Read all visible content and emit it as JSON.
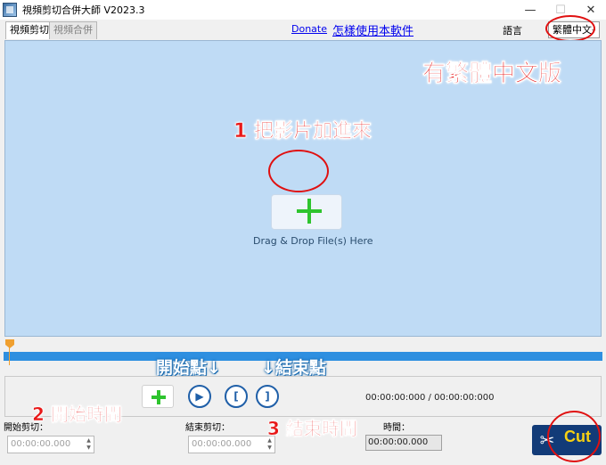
{
  "window": {
    "title": "視頻剪切合併大師 V2023.3",
    "minimize": "—",
    "maximize": "☐",
    "close": "✕"
  },
  "tabs": [
    {
      "label": "視頻剪切"
    },
    {
      "label": "視頻合併"
    }
  ],
  "links": {
    "donate": "Donate",
    "howto": "怎樣使用本軟件"
  },
  "language": {
    "label": "語言",
    "selected": "繁體中文"
  },
  "drop_area": {
    "text": "Drag & Drop File(s) Here"
  },
  "annotations": {
    "traditional_chinese": "有繁體中文版",
    "step1": "1 把影片加進來",
    "start_point": "開始點↓",
    "end_point": "↓結束點",
    "step2": "2 開始時間",
    "step3": "3 結束時間"
  },
  "controls": {
    "play_symbol": "▶",
    "mark_start_symbol": "[",
    "mark_end_symbol": "]",
    "time_total": "00:00:00:000 / 00:00:00:000"
  },
  "bottom": {
    "start_label": "開始剪切：",
    "start_value": "00:00:00.000",
    "end_label": "結束剪切：",
    "end_value": "00:00:00.000",
    "duration_label_partial": "時間：",
    "duration_value": "00:00:00.000",
    "cut_label": "Cut"
  },
  "colors": {
    "drop_bg": "#bfdbf5",
    "timeline": "#2e8fe0",
    "cut_bg": "#123b78",
    "cut_text": "#f6d012",
    "annotation_red": "#e81818"
  }
}
